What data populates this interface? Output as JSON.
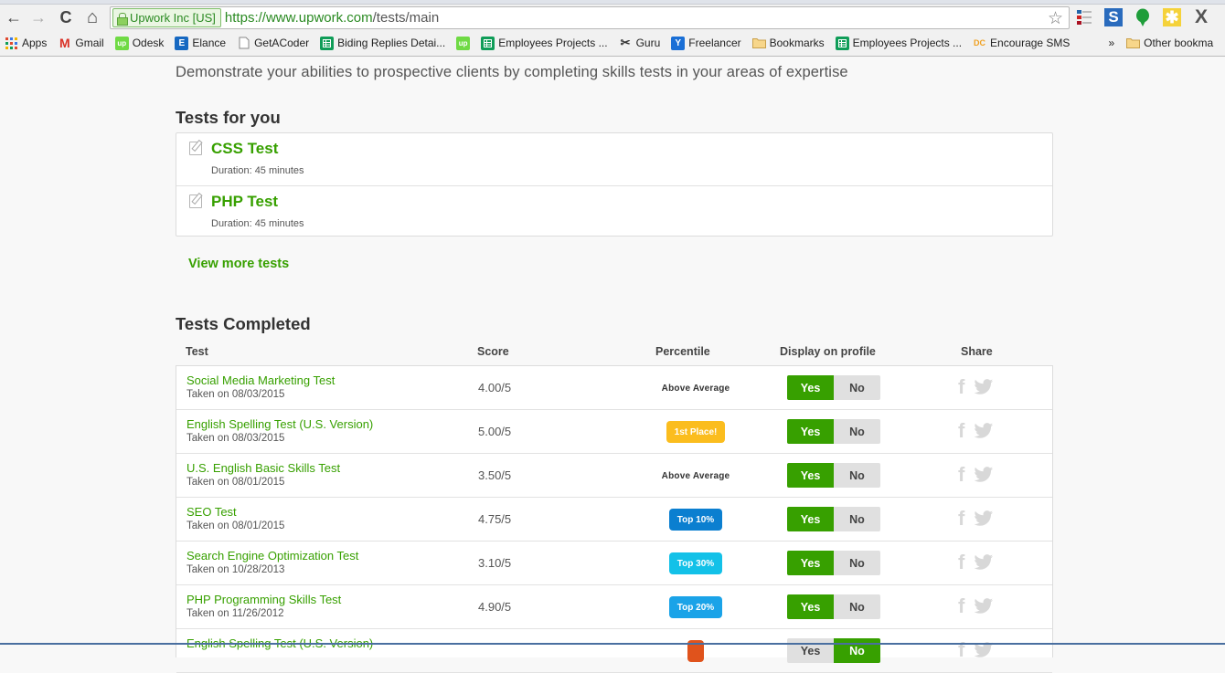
{
  "browser": {
    "nav": {
      "back": "←",
      "forward": "→",
      "reload": "C",
      "home": "⌂"
    },
    "ev_label": "Upwork Inc [US]",
    "url_scheme_host": "https://www.upwork.com",
    "url_path": "/tests/main",
    "extensions": [
      "list-ext-icon",
      "s-ext-icon",
      "green-drop-icon",
      "yellow-star-icon",
      "x-ext-icon"
    ],
    "bookmarks": [
      {
        "label": "Apps",
        "icon": "apps-grid-icon",
        "color": "#e04a2f"
      },
      {
        "label": "Gmail",
        "icon": "gmail-icon",
        "color": "#d93025"
      },
      {
        "label": "Odesk",
        "icon": "upwork-icon",
        "color": "#6fda44"
      },
      {
        "label": "Elance",
        "icon": "elance-icon",
        "color": "#1668c1"
      },
      {
        "label": "GetACoder",
        "icon": "page-icon",
        "color": "#ffffff"
      },
      {
        "label": "Biding Replies Detai...",
        "icon": "sheets-icon",
        "color": "#0f9d58"
      },
      {
        "label": "",
        "icon": "upwork-icon",
        "color": "#6fda44"
      },
      {
        "label": "Employees Projects ...",
        "icon": "sheets-icon",
        "color": "#0f9d58"
      },
      {
        "label": "Guru",
        "icon": "guru-icon",
        "color": "#333333"
      },
      {
        "label": "Freelancer",
        "icon": "freelancer-icon",
        "color": "#1a6fd6"
      },
      {
        "label": "Bookmarks",
        "icon": "folder-icon",
        "color": "#f3c96b"
      },
      {
        "label": "Employees Projects ...",
        "icon": "sheets-icon",
        "color": "#0f9d58"
      },
      {
        "label": "Encourage SMS",
        "icon": "dc-icon",
        "color": "#f0a020"
      }
    ],
    "overflow": "»",
    "other_bookmarks": "Other bookma"
  },
  "page": {
    "intro": "Demonstrate your abilities to prospective clients by completing skills tests in your areas of expertise",
    "tests_for_you": {
      "heading": "Tests for you",
      "items": [
        {
          "title": "CSS Test",
          "duration": "Duration: 45 minutes"
        },
        {
          "title": "PHP Test",
          "duration": "Duration: 45 minutes"
        }
      ],
      "view_more": "View more tests"
    },
    "completed": {
      "heading": "Tests Completed",
      "columns": [
        "Test",
        "Score",
        "Percentile",
        "Display on profile",
        "Share"
      ],
      "toggle_labels": {
        "yes": "Yes",
        "no": "No"
      },
      "rows": [
        {
          "name": "Social Media Marketing Test",
          "date": "Taken on 08/03/2015",
          "score": "4.00/5",
          "percentile": "Above Average",
          "badge_color": "",
          "display": "yes"
        },
        {
          "name": "English Spelling Test (U.S. Version)",
          "date": "Taken on 08/03/2015",
          "score": "5.00/5",
          "percentile": "1st Place!",
          "badge_color": "#fbbd1e",
          "display": "yes"
        },
        {
          "name": "U.S. English Basic Skills Test",
          "date": "Taken on 08/01/2015",
          "score": "3.50/5",
          "percentile": "Above Average",
          "badge_color": "",
          "display": "yes"
        },
        {
          "name": "SEO Test",
          "date": "Taken on 08/01/2015",
          "score": "4.75/5",
          "percentile": "Top 10%",
          "badge_color": "#0b7fd0",
          "display": "yes"
        },
        {
          "name": "Search Engine Optimization Test",
          "date": "Taken on 10/28/2013",
          "score": "3.10/5",
          "percentile": "Top 30%",
          "badge_color": "#13c1e8",
          "display": "yes"
        },
        {
          "name": "PHP Programming Skills Test",
          "date": "Taken on 11/26/2012",
          "score": "4.90/5",
          "percentile": "Top 20%",
          "badge_color": "#1aa3e8",
          "display": "yes"
        },
        {
          "name": "English Spelling Test (U.S. Version)",
          "date": "",
          "score": "",
          "percentile": "",
          "badge_color": "#e0531c",
          "display": "no"
        }
      ]
    }
  },
  "colors": {
    "brand_green": "#37a000",
    "toggle_off": "#e0e0e0",
    "share_icon": "#d8d8d8"
  }
}
